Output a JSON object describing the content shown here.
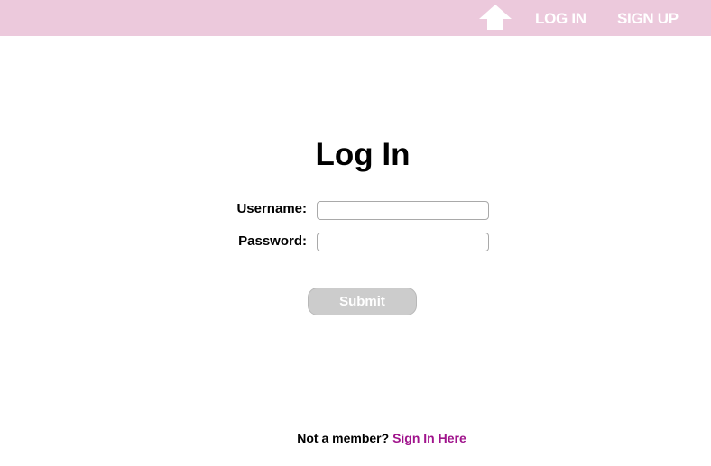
{
  "colors": {
    "topbar_background": "#ecc9dc",
    "nav_text": "#ffffff",
    "link_accent": "#a0148c",
    "submit_background": "#cccccc"
  },
  "header": {
    "home_icon": "home-arrow-icon",
    "nav": {
      "login_label": "LOG IN",
      "signup_label": "SIGN UP"
    }
  },
  "form": {
    "title": "Log In",
    "username": {
      "label": "Username:",
      "value": "",
      "placeholder": ""
    },
    "password": {
      "label": "Password:",
      "value": "",
      "placeholder": ""
    },
    "submit_label": "Submit"
  },
  "footer": {
    "prompt": "Not a member?",
    "link_label": "Sign In Here"
  }
}
